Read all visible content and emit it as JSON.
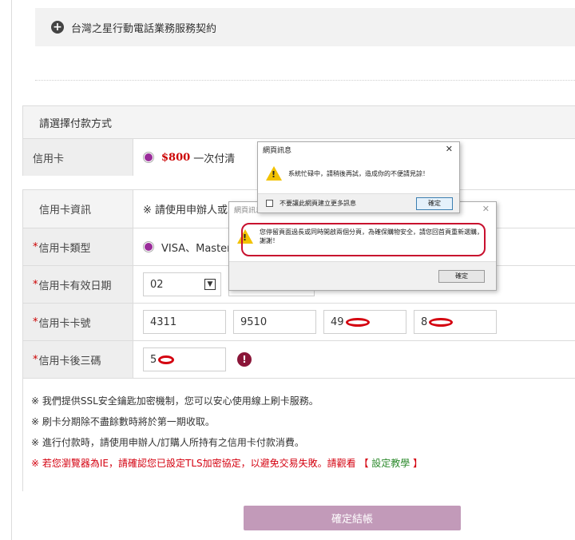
{
  "contract": {
    "label": "台灣之星行動電話業務服務契約"
  },
  "payment": {
    "heading": "請選擇付款方式",
    "method_label": "信用卡",
    "amount": "$800",
    "installment": "一次付清"
  },
  "card": {
    "heading_label": "信用卡資訊",
    "heading_note": "※ 請使用申辦人或",
    "type_label": "信用卡類型",
    "type_value": "VISA、Master",
    "expiry_label": "信用卡有效日期",
    "expiry_month": "02",
    "number_label": "信用卡卡號",
    "number_1": "4311",
    "number_2": "9510",
    "number_3": "49",
    "number_4": "8",
    "cvv_label": "信用卡後三碼",
    "cvv_value": "5",
    "required_mark": "*"
  },
  "notes": [
    "※ 我們提供SSL安全鑰匙加密機制，您可以安心使用線上刷卡服務。",
    "※ 刷卡分期除不盡餘數時將於第一期收取。",
    "※ 進行付款時，請使用申辦人/訂購人所持有之信用卡付款消費。"
  ],
  "ie_note": {
    "text": "※ 若您瀏覽器為IE，請確認您已設定TLS加密協定，以避免交易失敗。請觀看 【",
    "link": "設定教學",
    "end": "】"
  },
  "submit_label": "確定結帳",
  "dialog1": {
    "title": "網頁訊息",
    "message": "系統忙碌中，請稍後再試，造成你的不便請見諒！",
    "checkbox_label": "不要讓此網頁建立更多訊息",
    "ok": "確定",
    "close": "✕"
  },
  "dialog2": {
    "title": "網頁訊息",
    "message": "您停留頁面過長或同時開啟兩個分頁，為確保購物安全，請您回首頁重新選購，謝謝！",
    "ok": "確定",
    "close": "✕"
  },
  "colors": {
    "accent": "#9a2c9a",
    "required": "#cc0000",
    "submit_bg": "#c29ab9",
    "alert": "#8a1538"
  }
}
